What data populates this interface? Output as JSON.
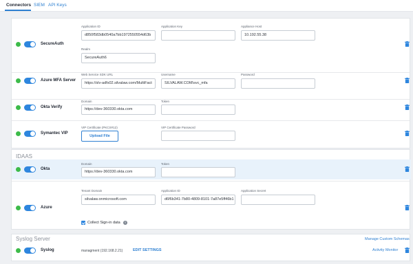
{
  "tabs": [
    {
      "label": "Connectors",
      "active": true
    },
    {
      "label": "SIEM",
      "active": false
    },
    {
      "label": "API Keys",
      "active": false
    }
  ],
  "connectors": {
    "secureauth": {
      "name": "SecureAuth",
      "enabled": true,
      "app_id": {
        "label": "Application ID",
        "value": "d850f583db0540a7bb1972550554d63b"
      },
      "app_key": {
        "label": "Application Key",
        "value": ""
      },
      "appliance_host": {
        "label": "Appliance Host",
        "value": "10.192.55.38"
      },
      "realm": {
        "label": "Realm",
        "value": "SecureAuth6"
      }
    },
    "azure_mfa": {
      "name": "Azure MFA Server",
      "enabled": true,
      "sdk_url": {
        "label": "Web Service SDK URL",
        "value": "https://slv-adfs02.silvalaw.com/MultiFact"
      },
      "username": {
        "label": "Username",
        "value": "SILVALAW.COM\\svc_mfa"
      },
      "password": {
        "label": "Password",
        "value": ""
      }
    },
    "okta_verify": {
      "name": "Okta Verify",
      "enabled": true,
      "domain": {
        "label": "Domain",
        "value": "https://dev-360330.okta.com"
      },
      "token": {
        "label": "Token",
        "value": ""
      }
    },
    "symantec": {
      "name": "Symantec VIP",
      "enabled": true,
      "cert": {
        "label": "VIP Certificate (PKCS#12)"
      },
      "upload_label": "Upload File",
      "cert_password": {
        "label": "VIP Certificate Password",
        "value": ""
      }
    }
  },
  "idaas": {
    "section_title": "IDAAS",
    "okta": {
      "name": "Okta",
      "enabled": true,
      "domain": {
        "label": "Domain",
        "value": "https://dev-360330.okta.com"
      },
      "token": {
        "label": "Token",
        "value": ""
      }
    },
    "azure": {
      "name": "Azure",
      "enabled": true,
      "tenant": {
        "label": "Tenant Domain",
        "value": "silvalaw.onmicrosoft.com"
      },
      "app_id": {
        "label": "Application ID",
        "value": "d6f6b341-7b80-4809-8101-7a87e5ff46b1"
      },
      "app_secret": {
        "label": "Application Secret",
        "value": ""
      },
      "collect_signin": {
        "label": "Collect Sign-in data",
        "checked": true
      }
    }
  },
  "syslog": {
    "section_title": "Syslog Server",
    "manage_schemas": "Manage Custom Schemas",
    "name": "Syslog",
    "enabled": true,
    "host_text": "managment (192.168.2.21)",
    "edit_settings": "EDIT SETTINGS",
    "activity_monitor": "Activity Monitor"
  },
  "colors": {
    "accent": "#2d7fd1",
    "status_ok": "#3dbb4a",
    "toggle_on": "#2e86de",
    "highlight_row": "#e8f2fb"
  },
  "icons": [
    "status-dot",
    "toggle-switch",
    "trash-icon",
    "info-icon",
    "checkbox-checked"
  ]
}
